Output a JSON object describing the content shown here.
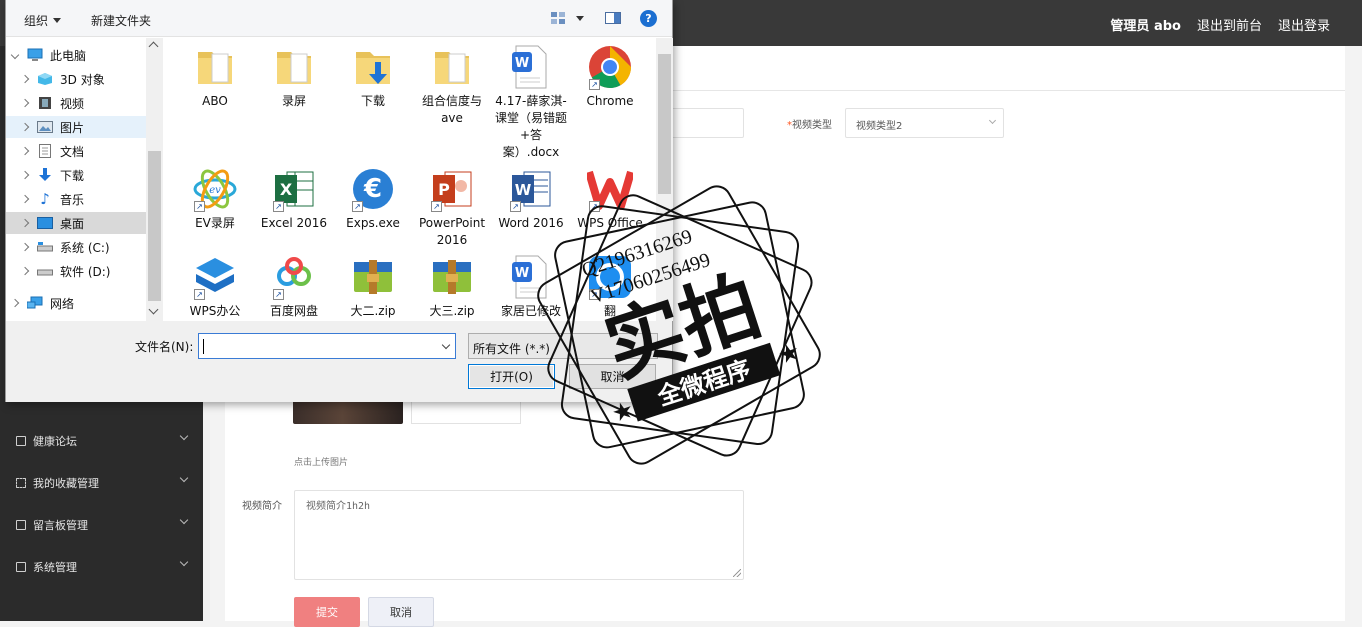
{
  "topbar": {
    "admin_label": "管理员 abo",
    "to_front": "退出到前台",
    "logout": "退出登录"
  },
  "sidebar": {
    "items": [
      {
        "label": "健康论坛",
        "icon": "chart-icon"
      },
      {
        "label": "我的收藏管理",
        "icon": "frame-icon"
      },
      {
        "label": "留言板管理",
        "icon": "monitor-icon"
      },
      {
        "label": "系统管理",
        "icon": "clipboard-icon"
      }
    ]
  },
  "form": {
    "video_type_label": "视频类型",
    "video_type_value": "视频类型2",
    "upload_hint": "点击上传图片",
    "intro_label": "视频简介",
    "intro_placeholder": "视频简介1h2h",
    "submit": "提交",
    "cancel": "取消"
  },
  "dialog": {
    "organize": "组织",
    "new_folder": "新建文件夹",
    "help": "?",
    "nav": [
      {
        "label": "此电脑",
        "icon": "computer-icon"
      },
      {
        "label": "3D 对象",
        "icon": "cube-icon"
      },
      {
        "label": "视频",
        "icon": "film-icon"
      },
      {
        "label": "图片",
        "icon": "picture-icon"
      },
      {
        "label": "文档",
        "icon": "document-icon"
      },
      {
        "label": "下载",
        "icon": "download-icon"
      },
      {
        "label": "音乐",
        "icon": "music-icon"
      },
      {
        "label": "桌面",
        "icon": "desktop-icon"
      },
      {
        "label": "系统 (C:)",
        "icon": "drive-icon"
      },
      {
        "label": "软件 (D:)",
        "icon": "drive-icon"
      },
      {
        "label": "网络",
        "icon": "network-icon"
      }
    ],
    "files": [
      {
        "label": "ABO",
        "icon": "folder-icon"
      },
      {
        "label": "录屏",
        "icon": "folder-icon"
      },
      {
        "label": "下载",
        "icon": "download-folder-icon"
      },
      {
        "label": "组合信度与ave",
        "icon": "folder-icon"
      },
      {
        "label": "4.17-薛家淇-课堂（易错题+答案）.docx",
        "icon": "wps-doc-icon"
      },
      {
        "label": "Chrome",
        "icon": "chrome-icon"
      },
      {
        "label": "EV录屏",
        "icon": "ev-icon"
      },
      {
        "label": "Excel 2016",
        "icon": "excel-icon"
      },
      {
        "label": "Exps.exe",
        "icon": "euro-icon"
      },
      {
        "label": "PowerPoint 2016",
        "icon": "powerpoint-icon"
      },
      {
        "label": "Word 2016",
        "icon": "word-icon"
      },
      {
        "label": "WPS Office",
        "icon": "wps-office-icon"
      },
      {
        "label": "WPS办公",
        "icon": "wps-box-icon"
      },
      {
        "label": "百度网盘",
        "icon": "baidu-icon"
      },
      {
        "label": "大二.zip",
        "icon": "zip-icon"
      },
      {
        "label": "大三.zip",
        "icon": "zip-icon"
      },
      {
        "label": "家居已修改",
        "icon": "wps-doc-icon"
      },
      {
        "label": "翻",
        "icon": "app-icon"
      }
    ],
    "filename_label": "文件名(N):",
    "filename_value": "",
    "filetype": "所有文件 (*.*)",
    "open": "打开(O)",
    "cancel": "取消"
  },
  "watermark": {
    "line1": "Q2196316269",
    "line2": "V17060256499",
    "big": "实拍",
    "banner": "全微程序"
  }
}
